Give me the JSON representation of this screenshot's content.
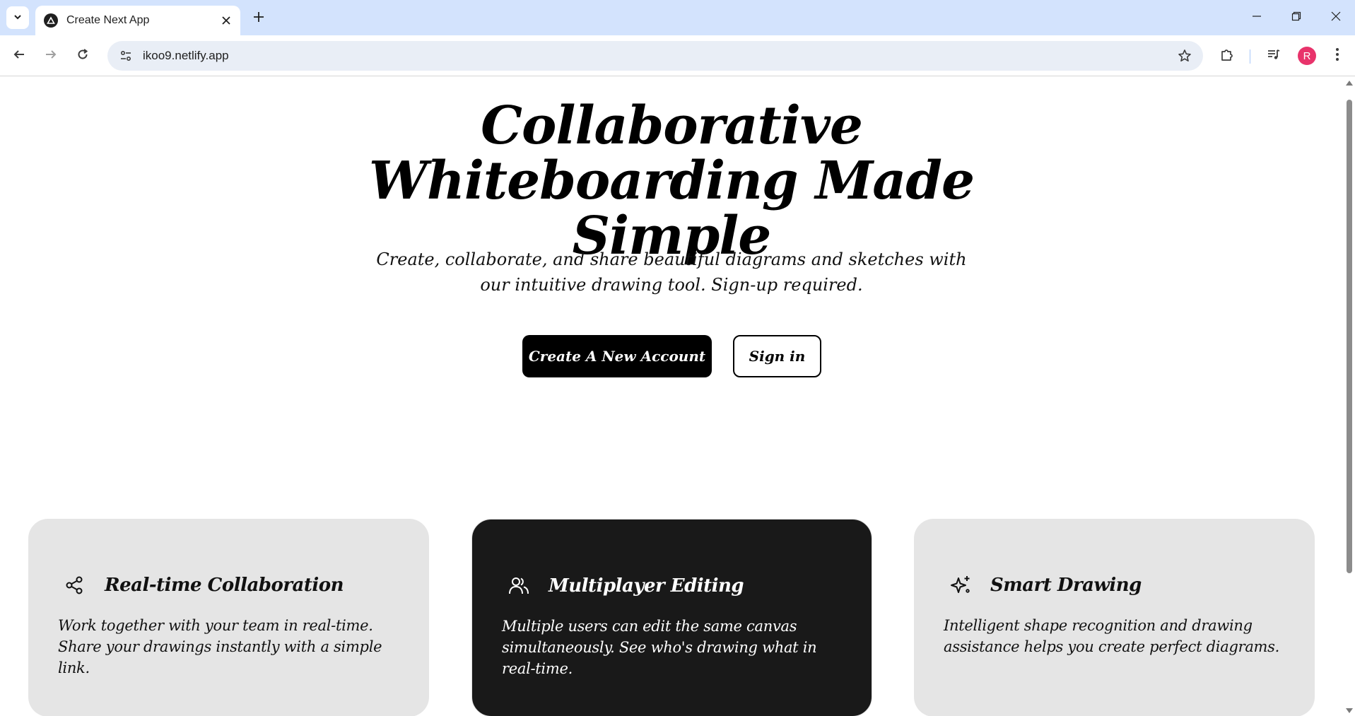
{
  "browser": {
    "tab_title": "Create Next App",
    "url": "ikoo9.netlify.app",
    "profile_initial": "R",
    "accent_color": "#d3e3fd",
    "profile_color": "#e8336b"
  },
  "hero": {
    "title": "Collaborative Whiteboarding Made Simple",
    "subtitle": "Create, collaborate, and share beautiful diagrams and sketches with our intuitive drawing tool. Sign-up required.",
    "primary_button": "Create A New Account",
    "secondary_button": "Sign in"
  },
  "features": [
    {
      "icon": "share-icon",
      "title": "Real-time Collaboration",
      "description": "Work together with your team in real-time. Share your drawings instantly with a simple link."
    },
    {
      "icon": "users-icon",
      "title": "Multiplayer Editing",
      "description": "Multiple users can edit the same canvas simultaneously. See who's drawing what in real-time."
    },
    {
      "icon": "sparkles-icon",
      "title": "Smart Drawing",
      "description": "Intelligent shape recognition and drawing assistance helps you create perfect diagrams."
    }
  ]
}
